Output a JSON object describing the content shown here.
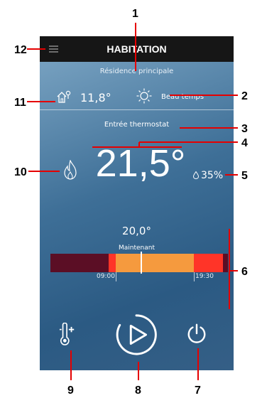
{
  "header": {
    "title": "HABITATION",
    "menu_icon": "hamburger-menu-icon"
  },
  "residence": {
    "name": "Résidence principale"
  },
  "outdoor": {
    "temperature": "11,8°",
    "home_icon": "home-thermometer-icon"
  },
  "weather": {
    "label": "Beau temps",
    "icon": "sun-icon"
  },
  "thermostat": {
    "label": "Entrée thermostat",
    "temperature": "21,5°",
    "humidity": "35%",
    "mode_icon": "flame-icon"
  },
  "schedule": {
    "setpoint": "20,0°",
    "now_label": "Maintenant",
    "start_time": "09:00",
    "end_time": "19:30",
    "colors": {
      "dark": "#5b0e25",
      "comfort": "#ff3428",
      "eco": "#f59a3e",
      "now_marker": "#ffffff"
    }
  },
  "controls": {
    "thermometer_boost_icon": "thermometer-plus-icon",
    "play_icon": "play-icon",
    "power_icon": "power-icon"
  },
  "callouts": [
    "1",
    "2",
    "3",
    "4",
    "5",
    "6",
    "7",
    "8",
    "9",
    "10",
    "11",
    "12"
  ],
  "colors": {
    "callout": "#e50000",
    "topbar": "#161616"
  }
}
